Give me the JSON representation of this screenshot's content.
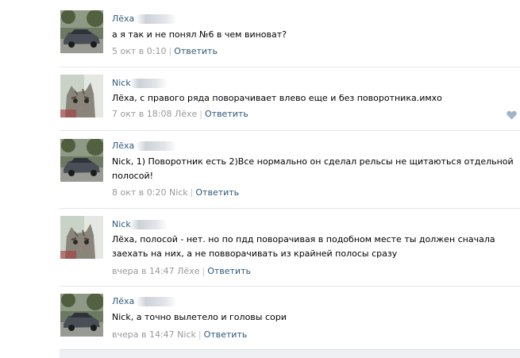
{
  "comments": [
    {
      "author": "Лёха",
      "text": "а я так и не понял №6 в чем виноват?",
      "time": "5 окт в 0:10",
      "reply_to": "",
      "reply_label": "Ответить",
      "avatar": "car"
    },
    {
      "author": "Nick",
      "text": "Лёха, с правого ряда поворачивает влево еще и без поворотника.имхо",
      "time": "7 окт в 18:08",
      "reply_to": "Лёхе",
      "reply_label": "Ответить",
      "avatar": "cat"
    },
    {
      "author": "Лёха",
      "text": "Nick, 1) Поворотник есть 2)Все нормально он сделал рельсы не щитаються отдельной полосой!",
      "time": "8 окт в 0:20",
      "reply_to": "Nick",
      "reply_label": "Ответить",
      "avatar": "car"
    },
    {
      "author": "Nick",
      "text": "Лёха, полосой - нет. но по пдд поворачивая в подобном месте ты должен сначала заехать на них, а не повворачивать из крайней полосы сразу",
      "time": "вчера в 14:47",
      "reply_to": "Лёхе",
      "reply_label": "Ответить",
      "avatar": "cat"
    },
    {
      "author": "Лёха",
      "text": "Nick, а точно вылетело и головы сори",
      "time": "вчера в 14:47",
      "reply_to": "Nick",
      "reply_label": "Ответить",
      "avatar": "car"
    }
  ],
  "icons": {
    "like": "heart-icon"
  },
  "colors": {
    "link": "#2b587a",
    "meta": "#999999",
    "like": "#9fb4cb"
  }
}
